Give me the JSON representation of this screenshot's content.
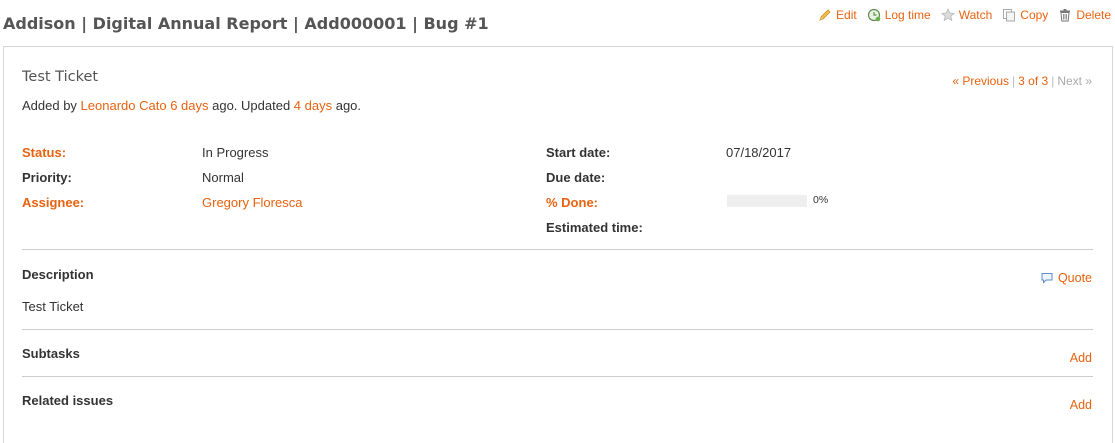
{
  "page": {
    "title": "Addison | Digital Annual Report | Add000001 | Bug #1"
  },
  "contextual": {
    "edit": "Edit",
    "log_time": "Log time",
    "watch": "Watch",
    "copy": "Copy",
    "delete": "Delete"
  },
  "issue": {
    "subject": "Test Ticket",
    "nav": {
      "previous": "« Previous",
      "position": "3 of 3",
      "next": "Next »"
    },
    "author_line": {
      "prefix": "Added by ",
      "author": "Leonardo Cato",
      "created_ago": "6 days",
      "middle": " ago. Updated ",
      "updated_ago": "4 days",
      "suffix": " ago."
    },
    "attributes": {
      "status_label": "Status:",
      "status_value": "In Progress",
      "priority_label": "Priority:",
      "priority_value": "Normal",
      "assignee_label": "Assignee:",
      "assignee_value": "Gregory Floresca",
      "start_date_label": "Start date:",
      "start_date_value": "07/18/2017",
      "due_date_label": "Due date:",
      "due_date_value": "",
      "done_label": "% Done:",
      "done_percent_text": "0%",
      "done_fraction": 0,
      "estimated_label": "Estimated time:",
      "estimated_value": ""
    },
    "description": {
      "title": "Description",
      "quote": "Quote",
      "text": "Test Ticket"
    },
    "subtasks": {
      "title": "Subtasks",
      "add": "Add"
    },
    "related": {
      "title": "Related issues",
      "add": "Add"
    }
  },
  "colors": {
    "accent": "#e8620f",
    "text": "#333333",
    "title": "#555555",
    "border": "#d7d7d7",
    "progress_track": "#eeeeee"
  },
  "icons": {
    "edit": "pencil-icon",
    "log_time": "clock-icon",
    "watch": "star-icon",
    "copy": "copy-icon",
    "delete": "trash-icon",
    "quote": "speech-bubble-icon"
  }
}
